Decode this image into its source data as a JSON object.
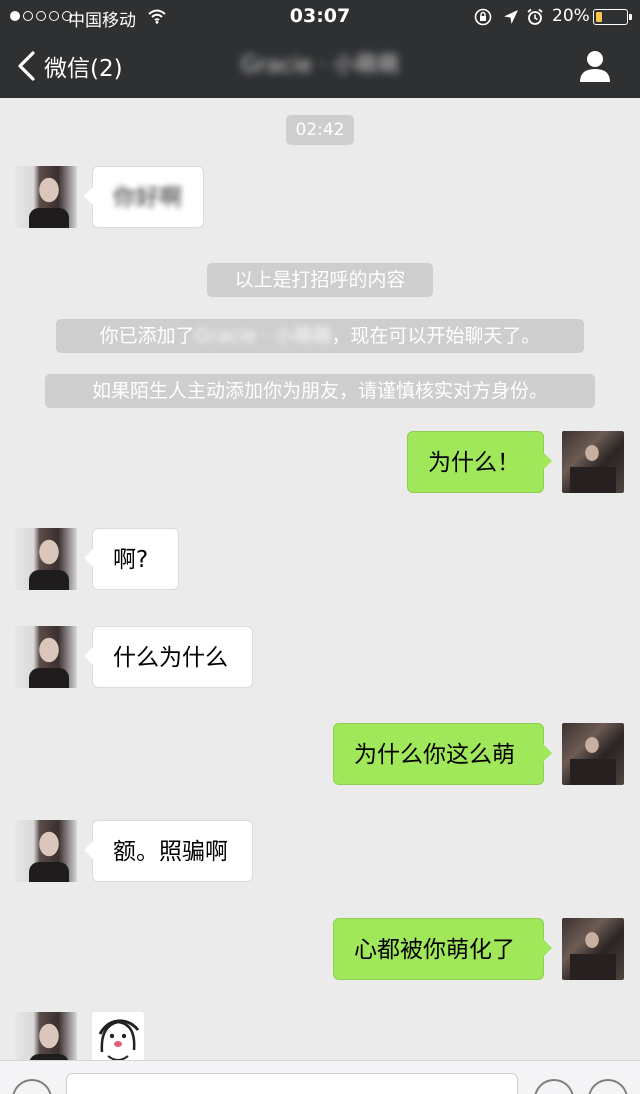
{
  "status_bar": {
    "carrier": "中国移动",
    "time": "03:07",
    "battery_percent": "20%",
    "battery_level": 0.2,
    "signal_bars_filled": 1,
    "signal_bars_total": 5,
    "icons": [
      "wifi-icon",
      "orientation-lock-icon",
      "location-arrow-icon",
      "alarm-icon",
      "battery-icon"
    ]
  },
  "nav": {
    "back_label": "微信(2)",
    "title": "Gracie · 小萌萌",
    "title_is_blurred": true,
    "right_icon": "contact-profile-icon"
  },
  "chat": {
    "timestamp": "02:42",
    "first_message": "你好啊",
    "system_notices": {
      "greeting_note": "以上是打招呼的内容",
      "added_prefix": "你已添加了",
      "added_name": "Gracie · 小萌萌",
      "added_suffix": "，现在可以开始聊天了。",
      "stranger_warning": "如果陌生人主动添加你为朋友，请谨慎核实对方身份。"
    },
    "messages": [
      {
        "sender": "me",
        "text": "为什么！"
      },
      {
        "sender": "them",
        "text": "啊?"
      },
      {
        "sender": "them",
        "text": "什么为什么"
      },
      {
        "sender": "me",
        "text": "为什么你这么萌"
      },
      {
        "sender": "them",
        "text": "额。照骗啊"
      },
      {
        "sender": "me",
        "text": "心都被你萌化了"
      },
      {
        "sender": "them",
        "type": "sticker",
        "icon": "cartoon-face-sticker"
      }
    ]
  },
  "colors": {
    "topbar": "#2e3032",
    "chat_background": "#ebebeb",
    "my_bubble": "#a0e75a",
    "their_bubble": "#ffffff",
    "system_pill": "#cecece",
    "battery": "#f7c64a"
  },
  "input_bar": {
    "left_icon": "voice-icon",
    "right_icons": [
      "emoji-icon",
      "add-icon"
    ]
  }
}
